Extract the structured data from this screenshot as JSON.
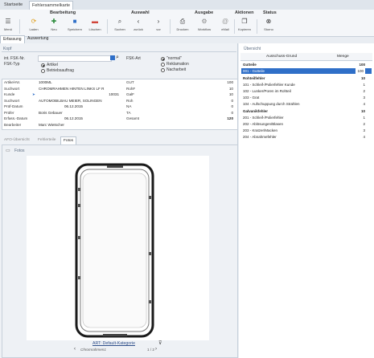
{
  "tabs": [
    "Startseite",
    "Fehlersammelkarte"
  ],
  "ribbon": {
    "groups": [
      "Bearbeitung",
      "Auswahl",
      "Ausgabe",
      "Aktionen",
      "Status"
    ],
    "buttons": [
      {
        "label": "Menü",
        "icon": "menu-icon"
      },
      {
        "label": "Laden",
        "icon": "reload-icon"
      },
      {
        "label": "Neu",
        "icon": "new-icon"
      },
      {
        "label": "Speichern",
        "icon": "save-icon"
      },
      {
        "label": "Löschen",
        "icon": "delete-icon"
      },
      {
        "label": "Suchen",
        "icon": "search-icon"
      },
      {
        "label": "zurück",
        "icon": "back-icon"
      },
      {
        "label": "vor",
        "icon": "forward-icon"
      },
      {
        "label": "Drucken",
        "icon": "print-icon"
      },
      {
        "label": "Workflow",
        "icon": "workflow-icon"
      },
      {
        "label": "eMail",
        "icon": "mail-icon"
      },
      {
        "label": "Kopieren",
        "icon": "copy-icon"
      },
      {
        "label": "Storno",
        "icon": "storno-icon"
      }
    ]
  },
  "subtabs": [
    "Erfassung",
    "Auswertung"
  ],
  "kopf": {
    "header": "Kopf",
    "int_fsk_label": "int. FSK-Nr.",
    "fsk_typ_label": "FSK-Typ",
    "fsk_typ_options": [
      "Artikel",
      "Betriebsauftrag"
    ],
    "fsk_art_label": "FSK-Art",
    "fsk_art_options": [
      "\"normal\"",
      "Reklamation",
      "Nacharbeit"
    ]
  },
  "fields": {
    "artikel_nr": {
      "label": "Artikel-Nr.",
      "value": "1000ML"
    },
    "suchwort": {
      "label": "Suchwort",
      "value": "CHROMRAHMEN HINTEN LINKS LF R"
    },
    "kunde": {
      "label": "Kunde",
      "value": "10031"
    },
    "suchwort2": {
      "label": "Suchwort",
      "value": "AUTOMOBILBAU MEIER, SOLINGEN"
    },
    "pruef_datum": {
      "label": "Prüf-Datum",
      "value": "06.12.2015"
    },
    "pruefer": {
      "label": "Prüfer",
      "value": "Boris Gebauer"
    },
    "erfass_datum": {
      "label": "Erfass.-Datum",
      "value": "06.12.2015"
    },
    "bearbeiter": {
      "label": "Bearbeiter",
      "value": "Marc Wietscher"
    }
  },
  "stats": [
    {
      "label": "GUT",
      "value": "100"
    },
    {
      "label": "RohF",
      "value": "10"
    },
    {
      "label": "GalF",
      "value": "10"
    },
    {
      "label": "Roh",
      "value": "0"
    },
    {
      "label": "NA",
      "value": "0"
    },
    {
      "label": "TA",
      "value": "0"
    },
    {
      "label": "Gesamt",
      "value": "120"
    }
  ],
  "bottom_tabs": [
    "AFO-Übersicht",
    "Fehlerteile",
    "Fotos"
  ],
  "fotos": {
    "header": "Fotos",
    "caption": "ART: Default-Kategorie",
    "filename": "Chromrahmen1",
    "pager": "1 / 2"
  },
  "overview": {
    "title": "Übersicht",
    "col1": "Ausschuss-Grund",
    "col2": "Menge",
    "rows": [
      {
        "name": "Gutteile",
        "value": "100",
        "group": true
      },
      {
        "name": "001 - Gutteile",
        "value": "100",
        "selected": true
      },
      {
        "name": "Rohteilfehler",
        "value": "10",
        "group": true
      },
      {
        "name": "101 - Schleif-/Polierfehler Kunde",
        "value": "1"
      },
      {
        "name": "102 - Lunker/Poren im Rohteil",
        "value": "2"
      },
      {
        "name": "103 - Grat",
        "value": "3"
      },
      {
        "name": "104 - Aufschuppung durch Strahlen",
        "value": "4"
      },
      {
        "name": "Galvanikfehler",
        "value": "10",
        "group": true
      },
      {
        "name": "201 - Schleif-/Polierfehler",
        "value": "1"
      },
      {
        "name": "202 - Ablösungen/Blasen",
        "value": "2"
      },
      {
        "name": "203 - Kratzer/Macken",
        "value": "3"
      },
      {
        "name": "204 - Abnahmefehler",
        "value": "4"
      }
    ]
  }
}
